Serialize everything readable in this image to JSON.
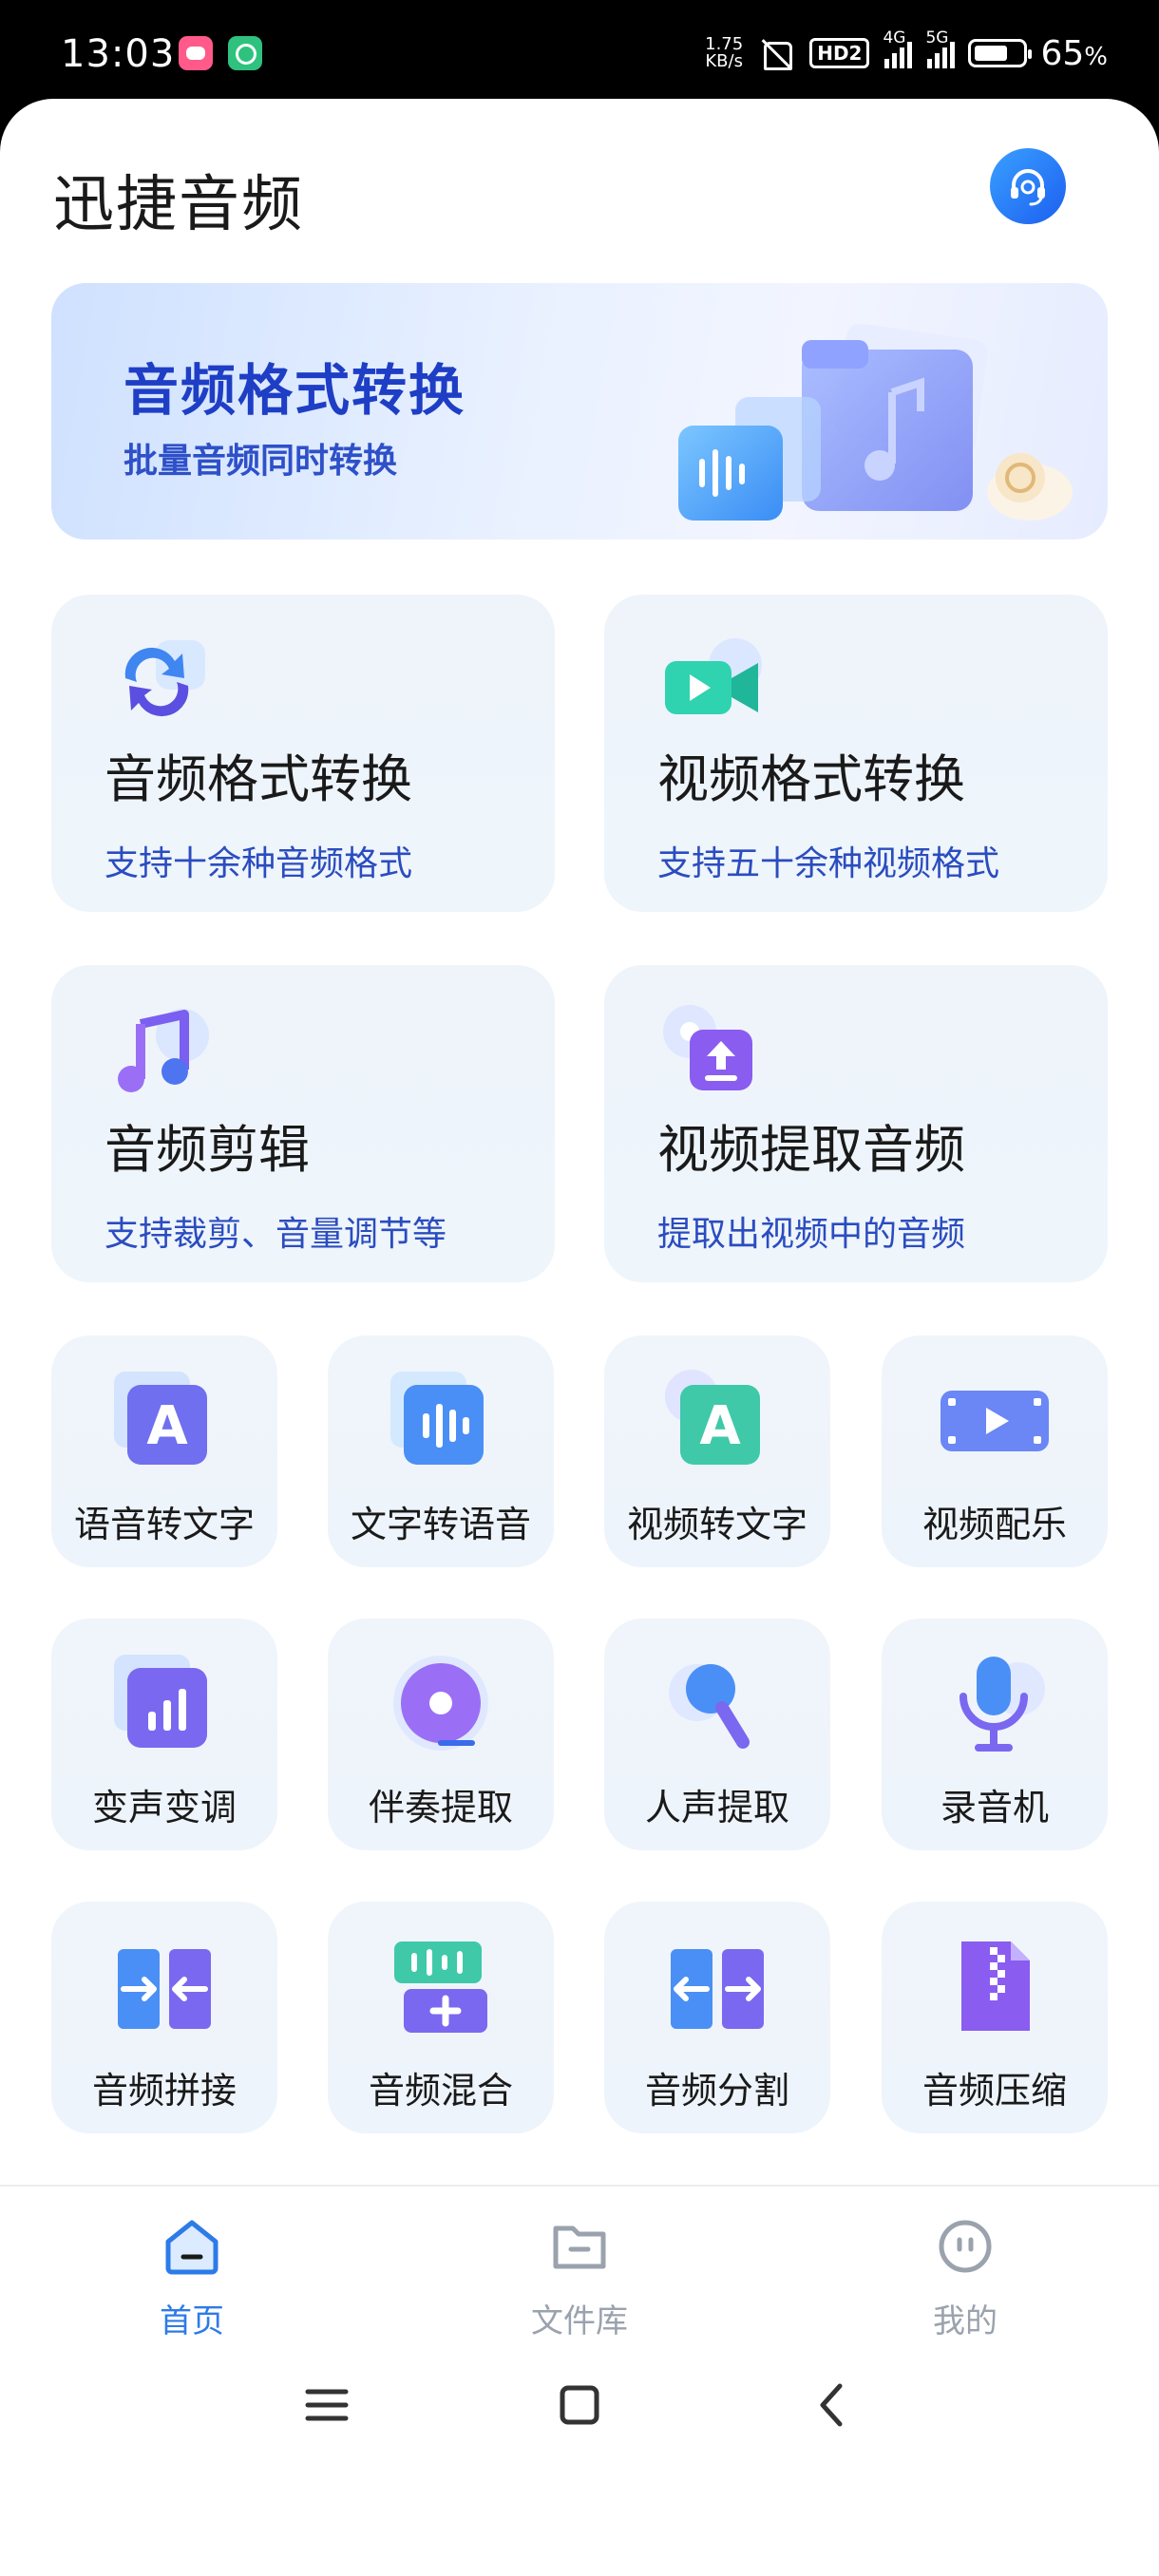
{
  "status_bar": {
    "time": "13:03",
    "net_speed_value": "1.75",
    "net_speed_unit": "KB/s",
    "hd_label": "HD2",
    "sim1_label": "4G",
    "sim2_label": "5G",
    "battery_percent": "65",
    "battery_unit": "%"
  },
  "header": {
    "title": "迅捷音频",
    "support_icon": "headset-icon"
  },
  "banner": {
    "title": "音频格式转换",
    "subtitle": "批量音频同时转换"
  },
  "features_big": [
    {
      "title": "音频格式转换",
      "subtitle": "支持十余种音频格式",
      "icon": "audio-convert-icon"
    },
    {
      "title": "视频格式转换",
      "subtitle": "支持五十余种视频格式",
      "icon": "video-camera-icon"
    },
    {
      "title": "音频剪辑",
      "subtitle": "支持裁剪、音量调节等",
      "icon": "music-note-icon"
    },
    {
      "title": "视频提取音频",
      "subtitle": "提取出视频中的音频",
      "icon": "upload-extract-icon"
    }
  ],
  "features_small": [
    {
      "label": "语音转文字",
      "icon": "letter-a-icon"
    },
    {
      "label": "文字转语音",
      "icon": "waveform-icon"
    },
    {
      "label": "视频转文字",
      "icon": "letter-a-video-icon"
    },
    {
      "label": "视频配乐",
      "icon": "film-play-icon"
    },
    {
      "label": "变声变调",
      "icon": "bar-chart-icon"
    },
    {
      "label": "伴奏提取",
      "icon": "vinyl-disc-icon"
    },
    {
      "label": "人声提取",
      "icon": "microphone-ball-icon"
    },
    {
      "label": "录音机",
      "icon": "microphone-icon"
    },
    {
      "label": "音频拼接",
      "icon": "merge-arrows-icon"
    },
    {
      "label": "音频混合",
      "icon": "mix-plus-icon"
    },
    {
      "label": "音频分割",
      "icon": "split-arrows-icon"
    },
    {
      "label": "音频压缩",
      "icon": "zip-file-icon"
    },
    {
      "label": "",
      "icon": "volume-bars-icon"
    },
    {
      "label": "",
      "icon": "triangle-icon"
    },
    {
      "label": "",
      "icon": "loop-icon"
    },
    {
      "label": "",
      "icon": "speed-dial-icon"
    }
  ],
  "bottom_nav": [
    {
      "label": "首页",
      "icon": "home-icon",
      "active": true
    },
    {
      "label": "文件库",
      "icon": "folder-icon",
      "active": false
    },
    {
      "label": "我的",
      "icon": "profile-face-icon",
      "active": false
    }
  ],
  "system_nav": [
    "menu-icon",
    "home-square-icon",
    "back-icon"
  ],
  "colors": {
    "accent": "#2d7be8",
    "banner_text": "#1e3ec5",
    "subtitle_text": "#2b4cbf",
    "card_bg": "#eff4fb"
  }
}
